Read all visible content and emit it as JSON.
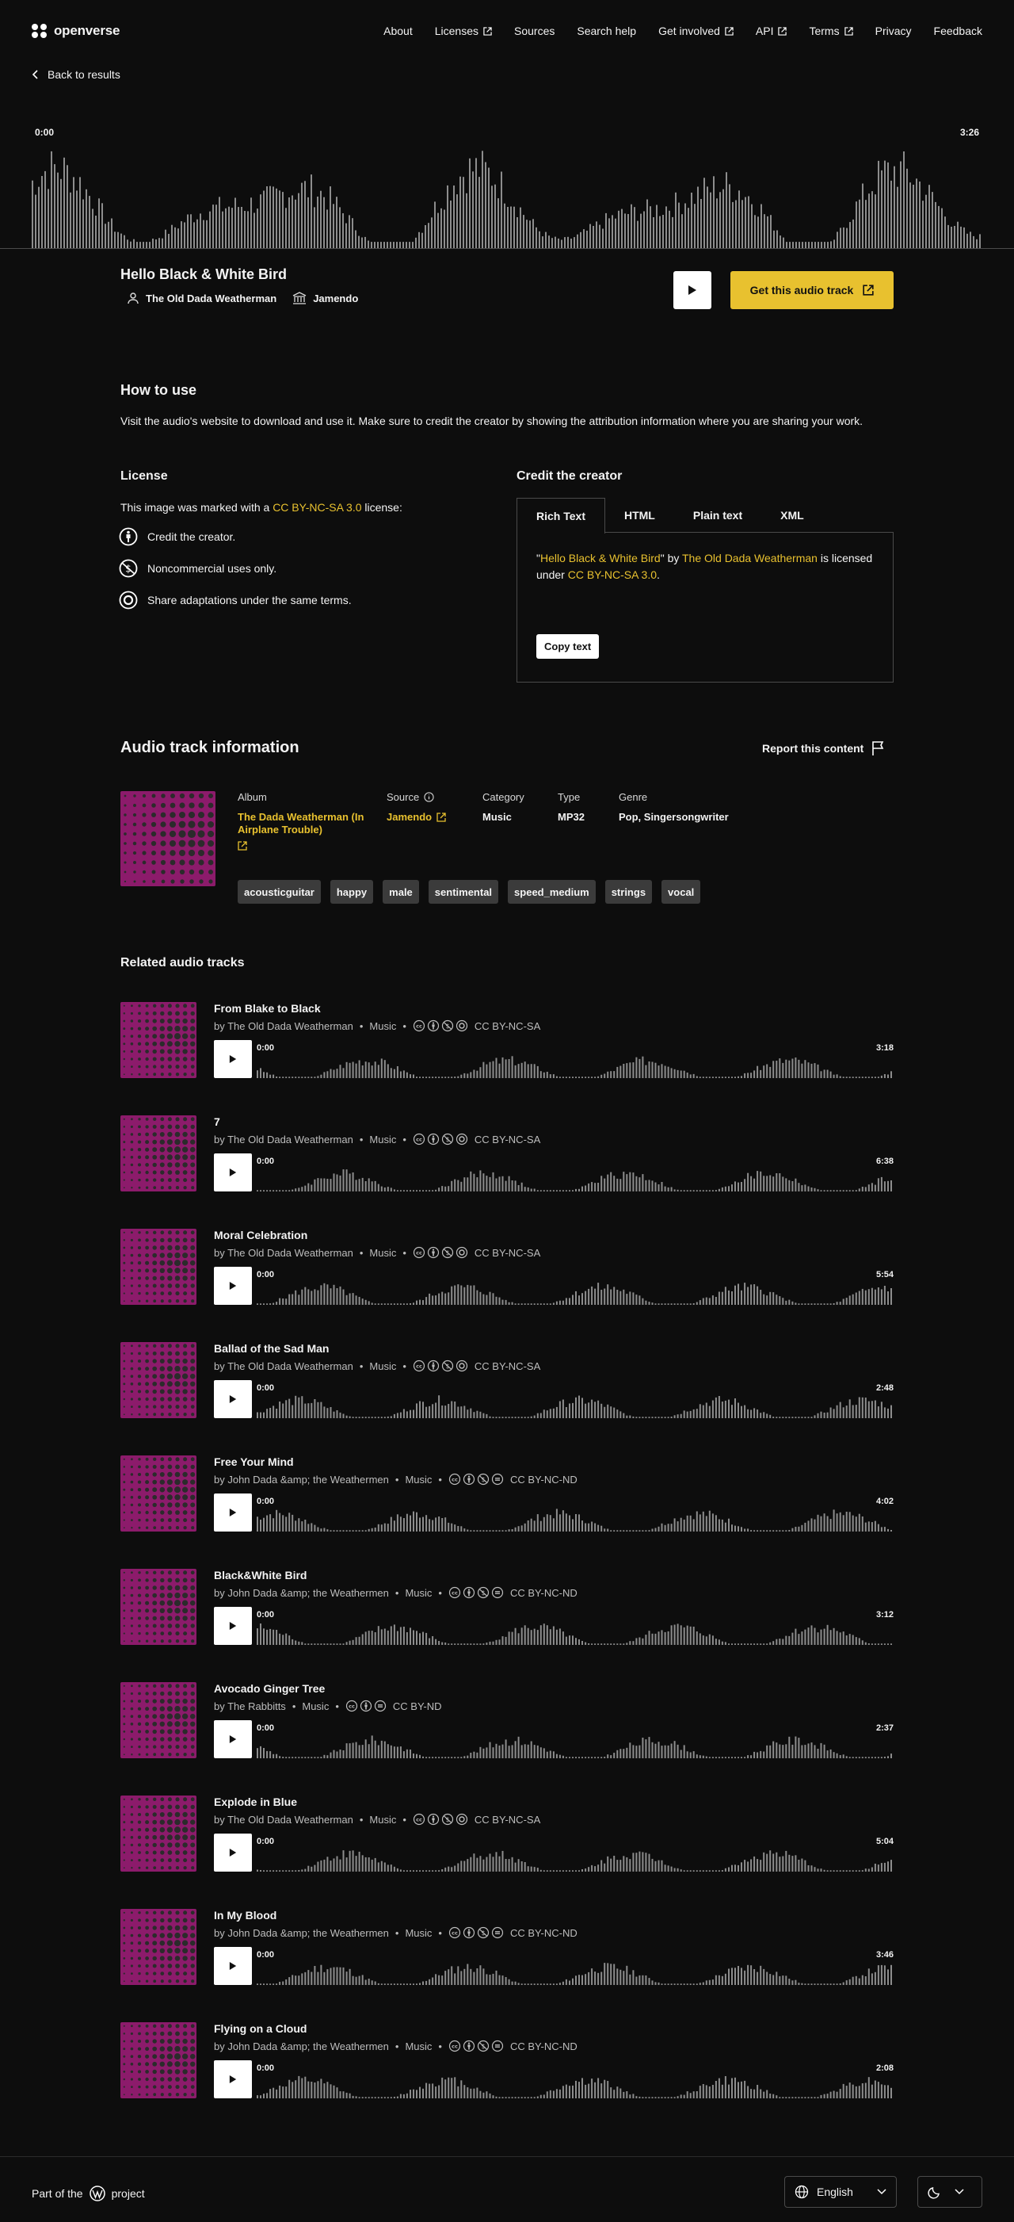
{
  "header": {
    "logo": "openverse",
    "nav": [
      {
        "label": "About",
        "external": false
      },
      {
        "label": "Licenses",
        "external": true
      },
      {
        "label": "Sources",
        "external": false
      },
      {
        "label": "Search help",
        "external": false
      },
      {
        "label": "Get involved",
        "external": true
      },
      {
        "label": "API",
        "external": true
      },
      {
        "label": "Terms",
        "external": true
      },
      {
        "label": "Privacy",
        "external": false
      },
      {
        "label": "Feedback",
        "external": false
      }
    ]
  },
  "back_label": "Back to results",
  "player": {
    "time_start": "0:00",
    "time_end": "3:26"
  },
  "track": {
    "title": "Hello Black & White Bird",
    "creator": "The Old Dada Weatherman",
    "source": "Jamendo",
    "get_label": "Get this audio track"
  },
  "how_to_use": {
    "heading": "How to use",
    "text": "Visit the audio's website to download and use it. Make sure to credit the creator by showing the attribution information where you are sharing your work."
  },
  "license": {
    "heading": "License",
    "intro_before": "This image was marked with a ",
    "license_name": "CC BY-NC-SA 3.0",
    "intro_after": " license:",
    "items": [
      "Credit the creator.",
      "Noncommercial uses only.",
      "Share adaptations under the same terms."
    ]
  },
  "credit": {
    "heading": "Credit the creator",
    "tabs": [
      "Rich Text",
      "HTML",
      "Plain text",
      "XML"
    ],
    "q1": "\"",
    "title": "Hello Black & White Bird",
    "q2": "\" by ",
    "creator": "The Old Dada Weatherman",
    "mid": " is licensed under ",
    "license": "CC BY-NC-SA 3.0",
    "end": ".",
    "copy_label": "Copy text"
  },
  "info": {
    "heading": "Audio track information",
    "report_label": "Report this content",
    "album_label": "Album",
    "album_value": "The Dada Weatherman (In Airplane Trouble)",
    "source_label": "Source",
    "source_value": "Jamendo",
    "category_label": "Category",
    "category_value": "Music",
    "type_label": "Type",
    "type_value": "MP32",
    "genre_label": "Genre",
    "genre_value": "Pop, Singersongwriter",
    "tags": [
      "acousticguitar",
      "happy",
      "male",
      "sentimental",
      "speed_medium",
      "strings",
      "vocal"
    ]
  },
  "related": {
    "heading": "Related audio tracks",
    "items": [
      {
        "title": "From Blake to Black",
        "creator": "by The Old Dada Weatherman",
        "category": "Music",
        "license": "CC BY-NC-SA",
        "t0": "0:00",
        "duration": "3:18"
      },
      {
        "title": "7",
        "creator": "by The Old Dada Weatherman",
        "category": "Music",
        "license": "CC BY-NC-SA",
        "t0": "0:00",
        "duration": "6:38"
      },
      {
        "title": "Moral Celebration",
        "creator": "by The Old Dada Weatherman",
        "category": "Music",
        "license": "CC BY-NC-SA",
        "t0": "0:00",
        "duration": "5:54"
      },
      {
        "title": "Ballad of the Sad Man",
        "creator": "by The Old Dada Weatherman",
        "category": "Music",
        "license": "CC BY-NC-SA",
        "t0": "0:00",
        "duration": "2:48"
      },
      {
        "title": "Free Your Mind",
        "creator": "by John Dada &amp; the Weathermen",
        "category": "Music",
        "license": "CC BY-NC-ND",
        "t0": "0:00",
        "duration": "4:02"
      },
      {
        "title": "Black&White Bird",
        "creator": "by John Dada &amp; the Weathermen",
        "category": "Music",
        "license": "CC BY-NC-ND",
        "t0": "0:00",
        "duration": "3:12"
      },
      {
        "title": "Avocado Ginger Tree",
        "creator": "by The Rabbitts",
        "category": "Music",
        "license": "CC BY-ND",
        "t0": "0:00",
        "duration": "2:37"
      },
      {
        "title": "Explode in Blue",
        "creator": "by The Old Dada Weatherman",
        "category": "Music",
        "license": "CC BY-NC-SA",
        "t0": "0:00",
        "duration": "5:04"
      },
      {
        "title": "In My Blood",
        "creator": "by John Dada &amp; the Weathermen",
        "category": "Music",
        "license": "CC BY-NC-ND",
        "t0": "0:00",
        "duration": "3:46"
      },
      {
        "title": "Flying on a Cloud",
        "creator": "by John Dada &amp; the Weathermen",
        "category": "Music",
        "license": "CC BY-NC-ND",
        "t0": "0:00",
        "duration": "2:08"
      }
    ]
  },
  "footer": {
    "part_of_before": "Part of the",
    "part_of_after": "project",
    "language": "English"
  },
  "colors": {
    "accent": "#e8c12f",
    "background": "#0d0d0d",
    "cover": "#8c1b6b"
  }
}
